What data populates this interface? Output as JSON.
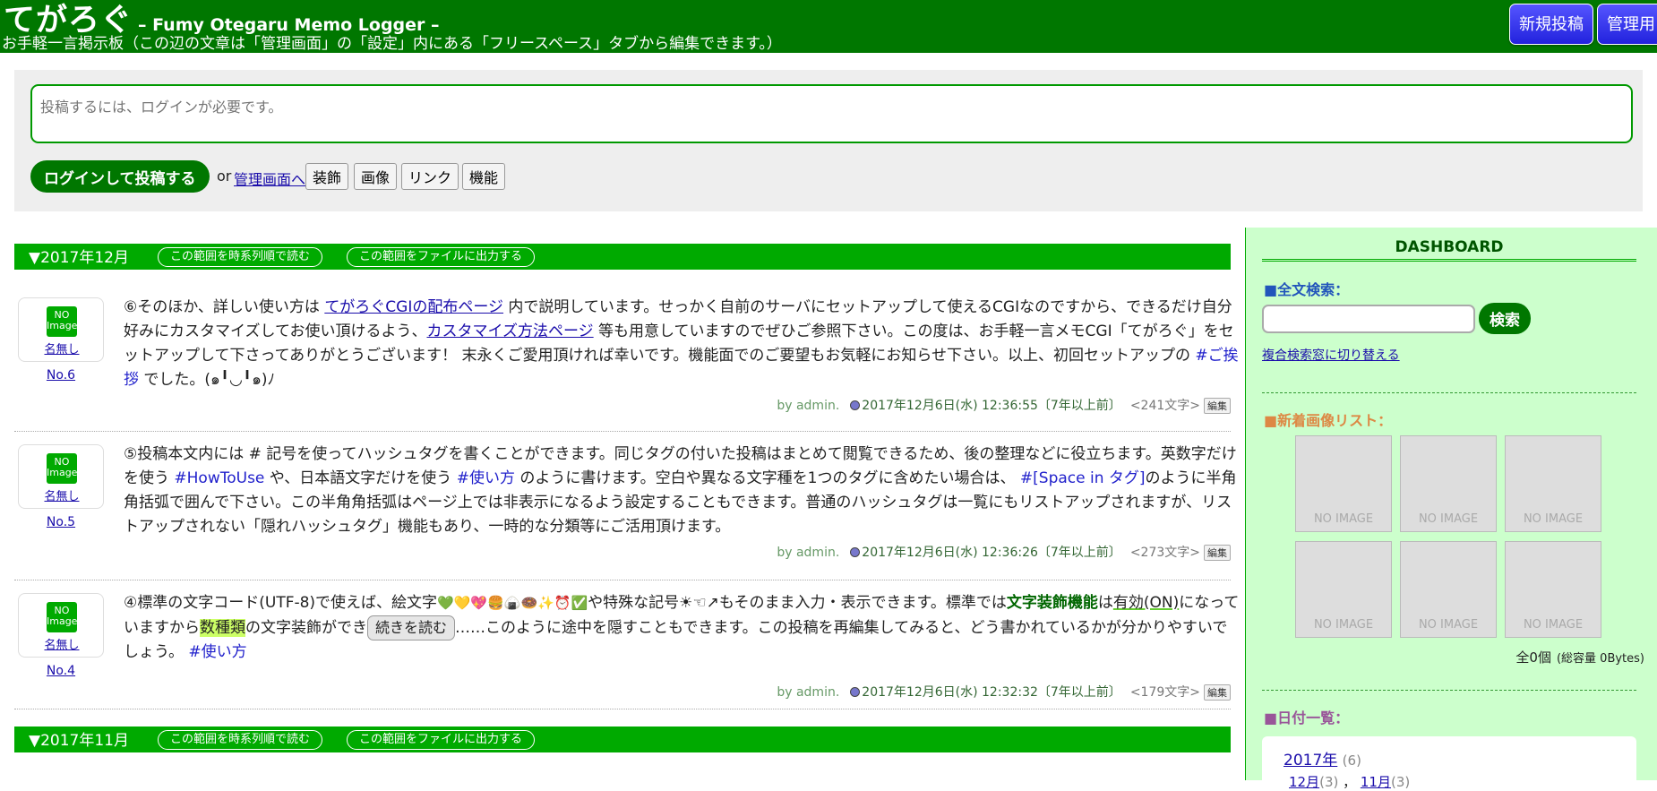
{
  "header": {
    "title": "てがろぐ",
    "subtitle": "– Fumy Otegaru Memo Logger –",
    "description": "お手軽一言掲示板（この辺の文章は「管理画面」の「設定」内にある「フリースペース」タブから編集できます。）",
    "new_post_btn": "新規投稿",
    "admin_btn": "管理用"
  },
  "form": {
    "placeholder": "投稿するには、ログインが必要です。",
    "login_post_btn": "ログインして投稿する",
    "or_text": "or",
    "admin_link": "管理画面へ",
    "tools": [
      "装飾",
      "画像",
      "リンク",
      "機能"
    ]
  },
  "months": [
    {
      "label": "▼2017年12月",
      "chron": "この範囲を時系列順で読む",
      "export": "この範囲をファイルに出力する"
    },
    {
      "label": "▼2017年11月",
      "chron": "この範囲を時系列順で読む",
      "export": "この範囲をファイルに出力する"
    }
  ],
  "avatar": {
    "icon_line1": "NO",
    "icon_line2": "Image",
    "name": "名無し"
  },
  "posts": [
    {
      "no": "No.6",
      "t1": "⑥そのほか、詳しい使い方は ",
      "link1": "てがろぐCGIの配布ページ",
      "t2": " 内で説明しています。せっかく自前のサーバにセットアップして使えるCGIなのですから、できるだけ自分好みにカスタマイズしてお使い頂けるよう、",
      "link2": "カスタマイズ方法ページ",
      "t3": " 等も用意していますのでぜひご参照下さい。この度は、お手軽一言メモCGI「てがろぐ」をセットアップして下さってありがとうございます！ 末永くご愛用頂ければ幸いです。機能面でのご要望もお気軽にお知らせ下さい。以上、初回セットアップの ",
      "tag1": "#ご挨拶",
      "t4": " でした。(๑╹◡╹๑)ﾉ",
      "by": "by admin.",
      "date": "2017年12月6日(水) 12:36:55〔7年以上前〕",
      "count": "<241文字>",
      "edit": "編集"
    },
    {
      "no": "No.5",
      "t1": "⑤投稿本文内には # 記号を使ってハッシュタグを書くことができます。同じタグの付いた投稿はまとめて閲覧できるため、後の整理などに役立ちます。英数字だけを使う ",
      "tag1": "#HowToUse",
      "t2": " や、日本語文字だけを使う ",
      "tag2": "#使い方",
      "t3": " のように書けます。空白や異なる文字種を1つのタグに含めたい場合は、 ",
      "tag3": "#[Space in タグ]",
      "t4": "のように半角角括弧で囲んで下さい。この半角角括弧はページ上では非表示になるよう設定することもできます。普通のハッシュタグは一覧にもリストアップされますが、リストアップされない「隠れハッシュタグ」機能もあり、一時的な分類等にご活用頂けます。",
      "by": "by admin.",
      "date": "2017年12月6日(水) 12:36:26〔7年以上前〕",
      "count": "<273文字>",
      "edit": "編集"
    },
    {
      "no": "No.4",
      "t1": "④標準の文字コード(UTF-8)で使えば、絵文字",
      "emoji": "💚💛💖🍔🍙🍩✨⏰✅",
      "t2": "や特殊な記号☀☜↗もそのまま入力・表示できます。標準では",
      "bold": "文字装飾機能",
      "t3": "は",
      "under": "有効(ON)",
      "t4": "になっていますから",
      "hl": "数種類",
      "t5": "の文字装飾ができ",
      "more": "続きを読む",
      "t6": "……このように途中を隠すこともできます。この投稿を再編集してみると、どう書かれているかが分かりやすいでしょう。 ",
      "tag1": "#使い方",
      "by": "by admin.",
      "date": "2017年12月6日(水) 12:32:32〔7年以上前〕",
      "count": "<179文字>",
      "edit": "編集"
    }
  ],
  "sidebar": {
    "dashboard": "DASHBOARD",
    "search_h": "■全文検索：",
    "search_btn": "検索",
    "adv_link": "複合検索窓に切り替える",
    "images_h": "■新着画像リスト：",
    "no_image": "NO IMAGE",
    "img_total": "全0個",
    "img_capacity": "(総容量 0Bytes)",
    "dates_h": "■日付一覧：",
    "year": "2017年",
    "year_count": "(6)",
    "month1": "12月",
    "month1_count": "(3)",
    "month2": "11月",
    "month2_count": "(3)"
  },
  "colors": {
    "header_bg": "#007700",
    "month_bar": "#00aa00",
    "sidebar_bg": "#ccffcc",
    "button_blue": "#2222dd"
  }
}
